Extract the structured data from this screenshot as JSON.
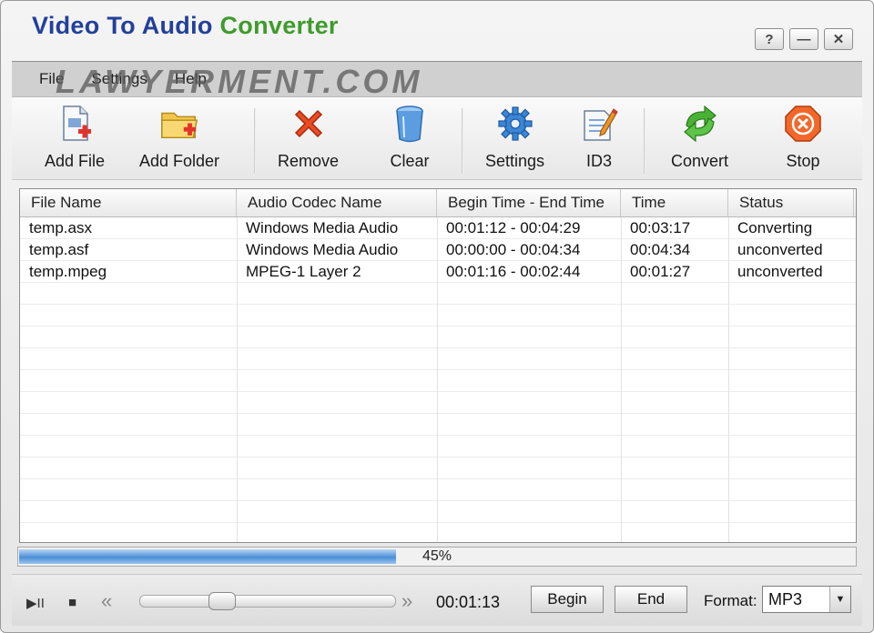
{
  "window": {
    "title_part1": "Video To Audio",
    "title_part2": "Converter",
    "help_label": "?",
    "minimize_label": "—",
    "close_label": "✕"
  },
  "menu": {
    "items": [
      {
        "label": "File"
      },
      {
        "label": "Settings"
      },
      {
        "label": "Help"
      }
    ]
  },
  "watermark": "LAWYERMENT.COM",
  "toolbar": {
    "add_file": "Add File",
    "add_folder": "Add Folder",
    "remove": "Remove",
    "clear": "Clear",
    "settings": "Settings",
    "id3": "ID3",
    "convert": "Convert",
    "stop": "Stop"
  },
  "list": {
    "columns": [
      "File Name",
      "Audio Codec Name",
      "Begin Time - End Time",
      "Time",
      "Status"
    ],
    "rows": [
      {
        "file": "temp.asx",
        "codec": "Windows Media Audio",
        "range": "00:01:12 - 00:04:29",
        "time": "00:03:17",
        "status": "Converting"
      },
      {
        "file": "temp.asf",
        "codec": "Windows Media Audio",
        "range": "00:00:00 - 00:04:34",
        "time": "00:04:34",
        "status": "unconverted"
      },
      {
        "file": "temp.mpeg",
        "codec": "MPEG-1 Layer 2",
        "range": "00:01:16 - 00:02:44",
        "time": "00:01:27",
        "status": "unconverted"
      }
    ]
  },
  "progress": {
    "value": 0.45,
    "label": "45%"
  },
  "player": {
    "play_pause": "▶II",
    "stop": "■",
    "rewind": "«",
    "forward": "»",
    "position": 0.3,
    "time": "00:01:13",
    "begin_label": "Begin",
    "end_label": "End",
    "format_label": "Format:",
    "format_value": "MP3"
  },
  "colors": {
    "title_blue": "#23409a",
    "title_green": "#3f9b2c",
    "progress_blue": "#4a8fd8"
  }
}
